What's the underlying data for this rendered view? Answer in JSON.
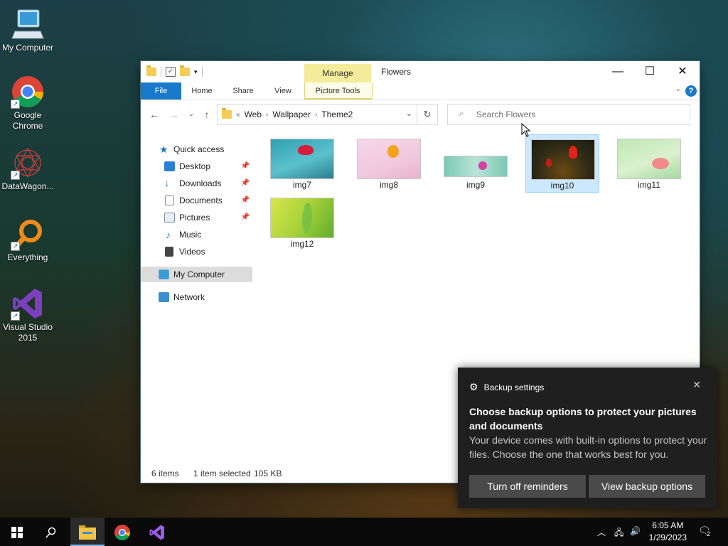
{
  "desktop": {
    "icons": [
      {
        "label": "My Computer"
      },
      {
        "label": "Google Chrome"
      },
      {
        "label": "DataWagon..."
      },
      {
        "label": "Everything"
      },
      {
        "label": "Visual Studio 2015"
      }
    ]
  },
  "window": {
    "title": "Flowers",
    "context_tab_top": "Manage",
    "ribbon_tabs": [
      "File",
      "Home",
      "Share",
      "View",
      "Picture Tools"
    ],
    "address": {
      "prefix": "«",
      "segments": [
        "Web",
        "Wallpaper",
        "Theme2"
      ]
    },
    "search_placeholder": "Search Flowers",
    "sidebar": [
      {
        "label": "Quick access",
        "pinned": false
      },
      {
        "label": "Desktop",
        "pinned": true
      },
      {
        "label": "Downloads",
        "pinned": true
      },
      {
        "label": "Documents",
        "pinned": true
      },
      {
        "label": "Pictures",
        "pinned": true
      },
      {
        "label": "Music",
        "pinned": false
      },
      {
        "label": "Videos",
        "pinned": false
      },
      {
        "label": "My Computer",
        "pinned": false,
        "selected": true
      },
      {
        "label": "Network",
        "pinned": false
      }
    ],
    "files": [
      {
        "name": "img7",
        "selected": false
      },
      {
        "name": "img8",
        "selected": false
      },
      {
        "name": "img9",
        "selected": false
      },
      {
        "name": "img10",
        "selected": true
      },
      {
        "name": "img11",
        "selected": false
      },
      {
        "name": "img12",
        "selected": false
      }
    ],
    "status": {
      "items": "6 items",
      "selection": "1 item selected",
      "size": "105 KB"
    }
  },
  "notification": {
    "header": "Backup settings",
    "title": "Choose backup options to protect your pictures and documents",
    "body": "Your device comes with built-in options to protect your files. Choose the one that works best for you.",
    "button_left": "Turn off reminders",
    "button_right": "View backup options"
  },
  "taskbar": {
    "time": "6:05 AM",
    "date": "1/29/2023",
    "notification_count": "2"
  },
  "colors": {
    "accent": "#1979ca",
    "selection": "#cce8ff",
    "toast_bg": "#1f1f1f"
  }
}
